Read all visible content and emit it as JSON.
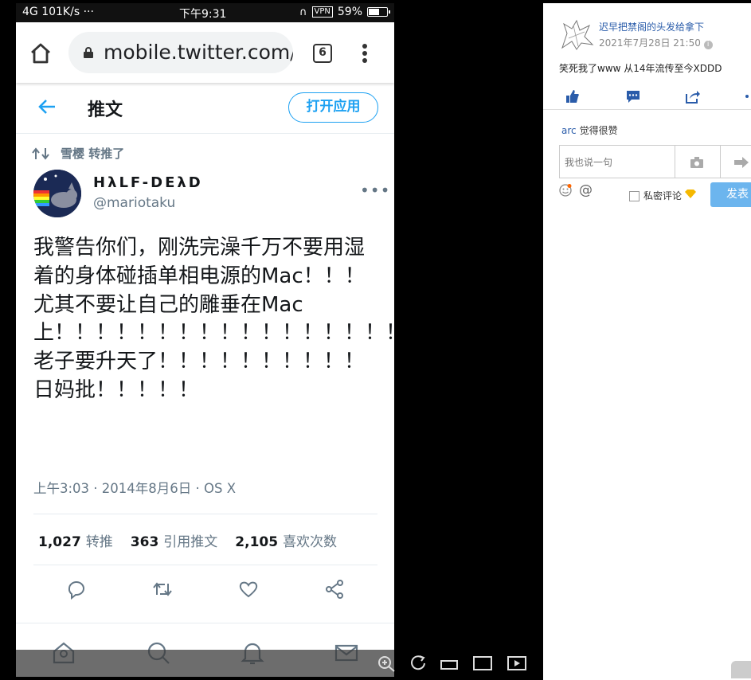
{
  "status_bar": {
    "signal": "4G 101K/s",
    "dots": "···",
    "time": "下午9:31",
    "vpn": "VPN",
    "battery": "59%"
  },
  "browser": {
    "url": "mobile.twitter.com/r",
    "tab_count": "6"
  },
  "twitter_header": {
    "title": "推文",
    "open_app": "打开应用"
  },
  "retweet": {
    "text": "雪樱 转推了"
  },
  "tweet": {
    "display_name": "HλLF-DEλD",
    "handle": "@mariotaku",
    "text": "我警告你们，刚洗完澡千万不要用湿着的身体碰插单相电源的Mac！！！尤其不要让自己的雕垂在Mac上！！！！！！！！！！！！！！！！！！老子要升天了！！！！！！！！！！日妈批！！！！！",
    "meta": "上午3:03 · 2014年8月6日 · OS X",
    "retweets_count": "1,027",
    "retweets_label": "转推",
    "quotes_count": "363",
    "quotes_label": "引用推文",
    "likes_count": "2,105",
    "likes_label": "喜欢次数"
  },
  "comment_panel": {
    "user": "迟早把禁阁的头发给拿下",
    "time": "2021年7月28日 21:50",
    "body": "笑死我了www 从14年流传至今XDDD",
    "like_user": "arc",
    "like_text": "觉得很赞",
    "input_placeholder": "我也说一句",
    "private_label": "私密评论",
    "submit_label": "发表"
  },
  "colors": {
    "twitter_blue": "#1da1f2",
    "link_blue": "#2a5caa",
    "submit_blue": "#6cb5ee"
  }
}
